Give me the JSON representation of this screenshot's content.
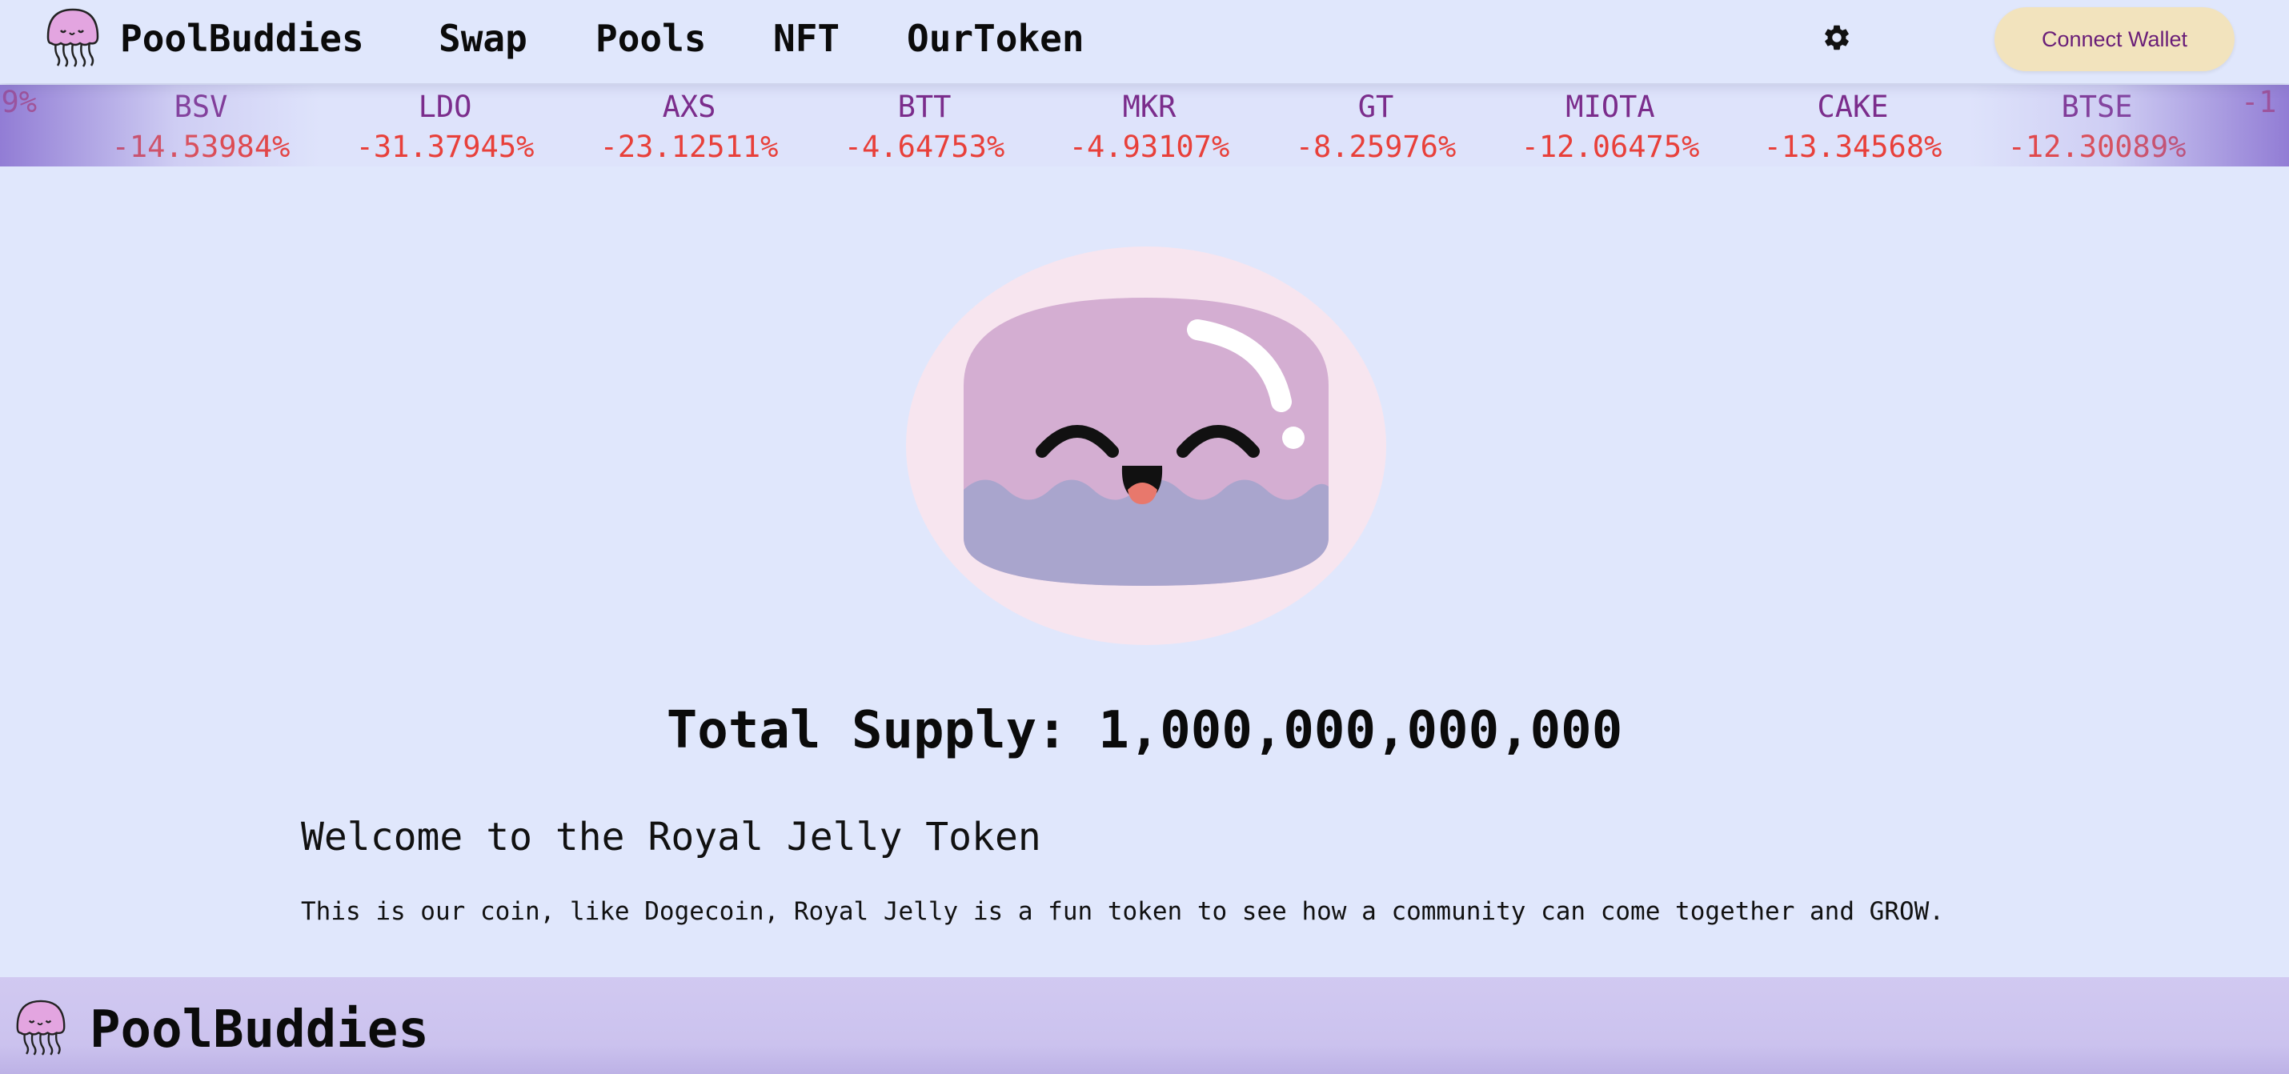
{
  "header": {
    "brand": "PoolBuddies",
    "nav": [
      {
        "label": "Swap"
      },
      {
        "label": "Pools"
      },
      {
        "label": "NFT"
      },
      {
        "label": "OurToken"
      }
    ],
    "settings_icon": "gear-icon",
    "connect_wallet_label": "Connect Wallet"
  },
  "ticker": {
    "items": [
      {
        "symbol": "",
        "change": "9%"
      },
      {
        "symbol": "BSV",
        "change": "-14.53984%"
      },
      {
        "symbol": "LDO",
        "change": "-31.37945%"
      },
      {
        "symbol": "AXS",
        "change": "-23.12511%"
      },
      {
        "symbol": "BTT",
        "change": "-4.64753%"
      },
      {
        "symbol": "MKR",
        "change": "-4.93107%"
      },
      {
        "symbol": "GT",
        "change": "-8.25976%"
      },
      {
        "symbol": "MIOTA",
        "change": "-12.06475%"
      },
      {
        "symbol": "CAKE",
        "change": "-13.34568%"
      },
      {
        "symbol": "BTSE",
        "change": "-12.30089%"
      },
      {
        "symbol": "",
        "change": "-1"
      }
    ]
  },
  "main": {
    "total_supply": "Total Supply: 1,000,000,000,000",
    "welcome_title": "Welcome to the Royal Jelly Token",
    "welcome_text": "This is our coin, like Dogecoin, Royal Jelly is a fun token to see how a community can come together and GROW."
  },
  "footer": {
    "brand": "PoolBuddies"
  },
  "colors": {
    "background": "#e0e7fc",
    "ticker_symbol": "#7b2d8c",
    "ticker_change_negative": "#e8403a",
    "connect_button_bg": "#f2e3bd",
    "connect_button_text": "#6a1e78",
    "footer_bg": "#d1c9f1"
  }
}
